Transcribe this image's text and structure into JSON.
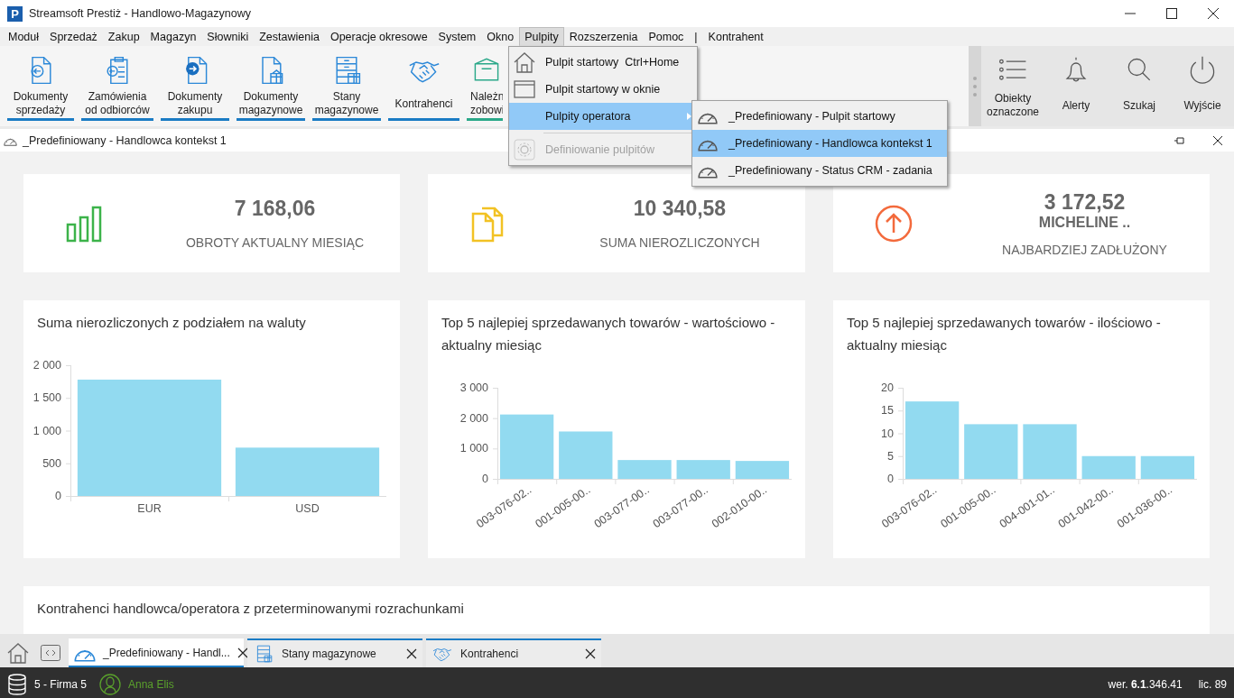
{
  "window": {
    "logo_letter": "P",
    "title": "Streamsoft Prestiż - Handlowo-Magazynowy"
  },
  "menu_bar": [
    {
      "label": "Moduł",
      "selected": false
    },
    {
      "label": "Sprzedaż",
      "selected": false
    },
    {
      "label": "Zakup",
      "selected": false
    },
    {
      "label": "Magazyn",
      "selected": false
    },
    {
      "label": "Słowniki",
      "selected": false
    },
    {
      "label": "Zestawienia",
      "selected": false
    },
    {
      "label": "Operacje okresowe",
      "selected": false
    },
    {
      "label": "System",
      "selected": false
    },
    {
      "label": "Okno",
      "selected": false
    },
    {
      "label": "Pulpity",
      "selected": true
    },
    {
      "label": "Rozszerzenia",
      "selected": false
    },
    {
      "label": "Pomoc",
      "selected": false
    },
    {
      "label": "|",
      "selected": false
    },
    {
      "label": "Kontrahent",
      "selected": false
    }
  ],
  "ribbon": {
    "buttons": [
      {
        "label": "Dokumenty sprzedaży",
        "color": "#1a7bc4"
      },
      {
        "label": "Zamówienia od odbiorców",
        "color": "#1a7bc4"
      },
      {
        "label": "Dokumenty zakupu",
        "color": "#1a7bc4"
      },
      {
        "label": "Dokumenty magazynowe",
        "color": "#1a7bc4"
      },
      {
        "label": "Stany magazynowe",
        "color": "#1a7bc4"
      },
      {
        "label": "Kontrahenci",
        "color": "#1a7bc4"
      },
      {
        "label": "Należn zobowi",
        "color": "#2aa889"
      }
    ],
    "right_buttons": [
      {
        "label": "Obiekty oznaczone"
      },
      {
        "label": "Alerty"
      },
      {
        "label": "Szukaj"
      },
      {
        "label": "Wyjście"
      }
    ]
  },
  "document": {
    "title": "_Predefiniowany - Handlowca kontekst 1"
  },
  "kpis": [
    {
      "value": "7 168,06",
      "label": "OBROTY AKTUALNY MIESIĄC"
    },
    {
      "value": "10 340,58",
      "label": "SUMA NIEROZLICZONYCH"
    },
    {
      "value": "3 172,52",
      "name": "MICHELINE ..",
      "label": "NAJBARDZIEJ ZADŁUŻONY"
    }
  ],
  "charts": [
    {
      "title": "Suma nierozliczonych z podziałem na waluty",
      "chart_data": {
        "type": "bar",
        "categories": [
          "EUR",
          "USD"
        ],
        "values": [
          1780,
          740
        ],
        "ylim": [
          0,
          2000
        ],
        "yticks": [
          {
            "value": 0,
            "label": "0"
          },
          {
            "value": 500,
            "label": "500"
          },
          {
            "value": 1000,
            "label": "1 000"
          },
          {
            "value": 1500,
            "label": "1 500"
          },
          {
            "value": 2000,
            "label": "2 000"
          }
        ]
      }
    },
    {
      "title": "Top 5 najlepiej sprzedawanych towarów - wartościowo - aktualny miesiąc",
      "chart_data": {
        "type": "bar",
        "categories": [
          "003-076-02..",
          "001-005-00..",
          "003-077-00..",
          "003-077-00..",
          "002-010-00.."
        ],
        "values": [
          2120,
          1560,
          620,
          620,
          590
        ],
        "ylim": [
          0,
          3000
        ],
        "yticks": [
          {
            "value": 0,
            "label": "0"
          },
          {
            "value": 1000,
            "label": "1 000"
          },
          {
            "value": 2000,
            "label": "2 000"
          },
          {
            "value": 3000,
            "label": "3 000"
          }
        ]
      }
    },
    {
      "title": "Top 5 najlepiej sprzedawanych towarów - ilościowo - aktualny miesiąc",
      "chart_data": {
        "type": "bar",
        "categories": [
          "003-076-02..",
          "001-005-00..",
          "004-001-01..",
          "001-042-00..",
          "001-036-00.."
        ],
        "values": [
          17,
          12,
          12,
          5,
          5
        ],
        "ylim": [
          0,
          20
        ],
        "yticks": [
          0,
          5,
          10,
          15,
          20
        ]
      }
    }
  ],
  "table_card": {
    "title": "Kontrahenci handlowca/operatora z przeterminowanymi rozrachunkami"
  },
  "tabs": [
    {
      "label": "_Predefiniowany - Handl...",
      "selected": true
    },
    {
      "label": "Stany magazynowe",
      "selected": false
    },
    {
      "label": "Kontrahenci",
      "selected": false
    }
  ],
  "status_bar": {
    "company": "5 - Firma 5",
    "user": "Anna Elis",
    "version": "wer. **6.1**.346.41",
    "license": "lic. 89"
  },
  "pulpity_menu": {
    "items": [
      {
        "kind": "item",
        "label": "Pulpit startowy",
        "shortcut": "Ctrl+Home",
        "selected": false,
        "disabled": false
      },
      {
        "kind": "item",
        "label": "Pulpit startowy w oknie",
        "selected": false,
        "disabled": false
      },
      {
        "kind": "submenu",
        "label": "Pulpity operatora",
        "selected": true,
        "disabled": false
      },
      {
        "kind": "separator"
      },
      {
        "kind": "item",
        "label": "Definiowanie pulpitów",
        "selected": false,
        "disabled": true
      }
    ]
  },
  "submenu": {
    "items": [
      {
        "label": "_Predefiniowany - Pulpit startowy",
        "selected": false
      },
      {
        "label": "_Predefiniowany - Handlowca kontekst 1",
        "selected": true
      },
      {
        "label": "_Predefiniowany - Status CRM - zadania",
        "selected": false
      }
    ]
  }
}
